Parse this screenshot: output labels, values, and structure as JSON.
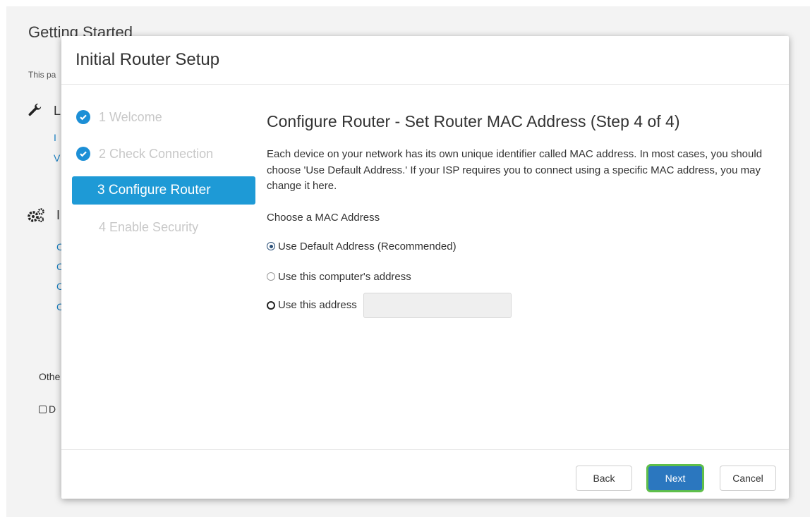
{
  "background": {
    "title": "Getting Started",
    "description": "This pa",
    "section1_letter": "L",
    "section1_links": [
      "I",
      "V"
    ],
    "section2_letter": "I",
    "section2_links": [
      "C",
      "C",
      "C",
      "C"
    ],
    "other_label": "Othe",
    "checkbox_label": "D"
  },
  "modal": {
    "title": "Initial Router Setup",
    "steps": [
      {
        "label": "1 Welcome",
        "state": "done"
      },
      {
        "label": "2 Check Connection",
        "state": "done"
      },
      {
        "label": "3 Configure Router",
        "state": "active"
      },
      {
        "label": "4 Enable Security",
        "state": "pending"
      }
    ],
    "heading": "Configure Router - Set Router MAC Address (Step 4 of 4)",
    "paragraph": "Each device on your network has its own unique identifier called MAC address. In most cases, you should choose 'Use Default Address.' If your ISP requires you to connect using a specific MAC address, you may change it here.",
    "choose_label": "Choose a MAC Address",
    "options": [
      {
        "label": "Use Default Address (Recommended)",
        "checked": true
      },
      {
        "label": "Use this computer's address",
        "checked": false
      },
      {
        "label": "Use this address",
        "checked": false
      }
    ],
    "address_value": "",
    "buttons": {
      "back": "Back",
      "next": "Next",
      "cancel": "Cancel"
    }
  },
  "colors": {
    "accent": "#1e9ad6",
    "primary_button": "#2b77bf",
    "focus_ring": "#5fbf4a",
    "link": "#1a7fc1"
  }
}
